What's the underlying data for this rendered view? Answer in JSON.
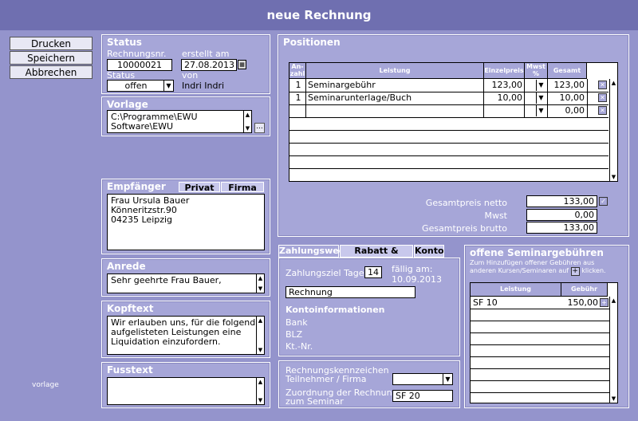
{
  "window": {
    "title": "neue Rechnung"
  },
  "actions": {
    "print": "Drucken",
    "save": "Speichern",
    "cancel": "Abbrechen"
  },
  "status": {
    "title": "Status",
    "invoice_nr_label": "Rechnungsnr.",
    "invoice_nr": "10000021",
    "created_label": "erstellt am",
    "created_date": "27.08.2013",
    "status_label": "Status",
    "status_value": "offen",
    "by_label": "von",
    "by_value": "Indri Indri"
  },
  "template": {
    "title": "Vorlage",
    "path_line1": "C:\\Programme\\EWU",
    "path_line2": "Software\\EWU",
    "browse": "..."
  },
  "recipient": {
    "title": "Empfänger",
    "private_tab": "Privat",
    "company_tab": "Firma",
    "line1": "Frau Ursula Bauer",
    "line2": "Könneritzstr.90",
    "line3": "04235 Leipzig"
  },
  "salutation": {
    "title": "Anrede",
    "value": "Sehr geehrte Frau Bauer,"
  },
  "header_text": {
    "title": "Kopftext",
    "line1": "Wir erlauben uns, für die folgend",
    "line2": "aufgelisteten Leistungen eine",
    "line3": "Liquidation einzufordern."
  },
  "footer_text": {
    "title": "Fusstext"
  },
  "footer_note": "vorlage",
  "positions": {
    "title": "Positionen",
    "col_qty_1": "An-",
    "col_qty_2": "zahl",
    "col_service": "Leistung",
    "col_unit": "Einzelpreis",
    "col_vat_1": "Mwst",
    "col_vat_2": "%",
    "col_total": "Gesamt",
    "rows": [
      {
        "qty": "1",
        "service": "Seminargebühr",
        "unit": "123,00",
        "total": "123,00"
      },
      {
        "qty": "1",
        "service": "Seminarunterlage/Buch",
        "unit": "10,00",
        "total": "10,00"
      },
      {
        "qty": "",
        "service": "",
        "unit": "",
        "total": "0,00"
      }
    ]
  },
  "totals": {
    "net_label": "Gesamtpreis netto",
    "net": "133,00",
    "vat_label": "Mwst",
    "vat": "0,00",
    "gross_label": "Gesamtpreis brutto",
    "gross": "133,00"
  },
  "payment": {
    "tab_payment": "Zahlungsweg",
    "tab_discount": "Rabatt & Skonto",
    "tab_account": "Konto",
    "term_label": "Zahlungsziel Tage",
    "term_days": "14",
    "due_label": "fällig am:",
    "due_date": "10.09.2013",
    "method": "Rechnung",
    "account_info_label": "Kontoinformationen",
    "bank_label": "Bank",
    "blz_label": "BLZ",
    "kto_label": "Kt.-Nr."
  },
  "reference": {
    "id_label_1": "Rechnungskennzeichen",
    "id_label_2": "Teilnehmer / Firma",
    "seminar_label_1": "Zuordnung der Rechnung",
    "seminar_label_2": "zum Seminar",
    "seminar_value": "SF 20"
  },
  "open_fees": {
    "title": "offene Seminargebühren",
    "hint_1": "Zum Hinzufügen offener Gebühren aus",
    "hint_2a": "anderen Kursen/Seminaren auf",
    "hint_2b": "klicken.",
    "col_service": "Leistung",
    "col_fee": "Gebühr",
    "rows": [
      {
        "service": "SF 10",
        "fee": "150,00"
      }
    ]
  }
}
